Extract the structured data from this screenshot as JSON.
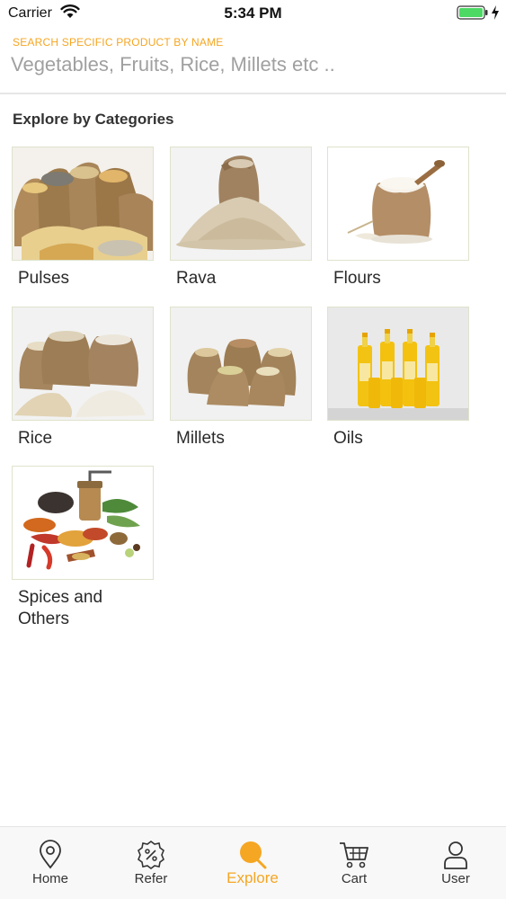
{
  "status_bar": {
    "carrier": "Carrier",
    "time": "5:34 PM",
    "battery_color": "#4cd964"
  },
  "search": {
    "caption": "SEARCH SPECIFIC PRODUCT BY NAME",
    "placeholder": "Vegetables, Fruits, Rice, Millets etc ..",
    "value": ""
  },
  "explore": {
    "title": "Explore by Categories",
    "categories": [
      {
        "label": "Pulses",
        "image": "pulses-sacks-image"
      },
      {
        "label": "Rava",
        "image": "rava-sack-image"
      },
      {
        "label": "Flours",
        "image": "flour-sack-image"
      },
      {
        "label": "Rice",
        "image": "rice-sacks-image"
      },
      {
        "label": "Millets",
        "image": "millets-sacks-image"
      },
      {
        "label": "Oils",
        "image": "oil-bottles-image"
      },
      {
        "label": "Spices and Others",
        "image": "spices-image"
      }
    ]
  },
  "tab_bar": {
    "active_color": "#f5a623",
    "tabs": [
      {
        "label": "Home",
        "icon": "location-pin-icon",
        "active": false
      },
      {
        "label": "Refer",
        "icon": "discount-badge-icon",
        "active": false
      },
      {
        "label": "Explore",
        "icon": "search-icon",
        "active": true
      },
      {
        "label": "Cart",
        "icon": "cart-icon",
        "active": false
      },
      {
        "label": "User",
        "icon": "user-icon",
        "active": false
      }
    ]
  }
}
